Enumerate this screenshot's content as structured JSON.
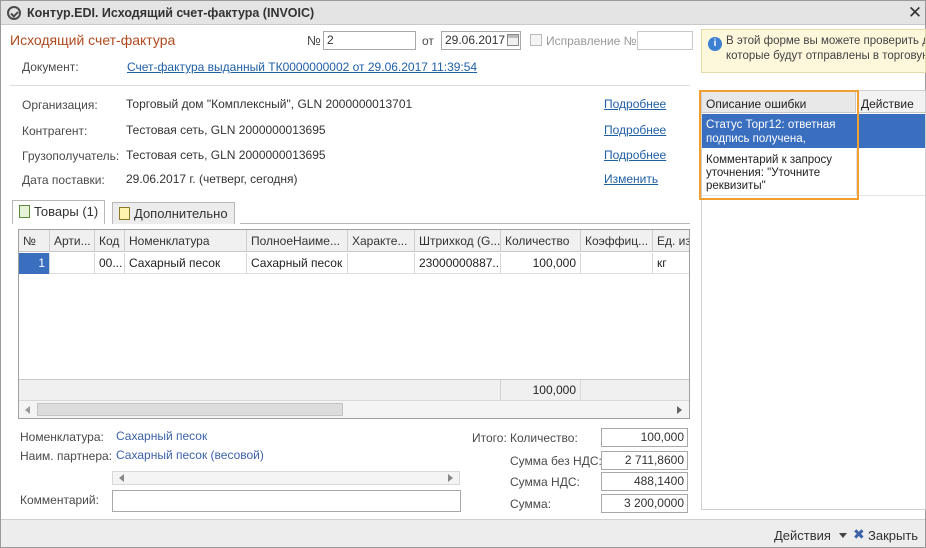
{
  "window": {
    "title": "Контур.EDI. Исходящий счет-фактура (INVOIC)"
  },
  "header": {
    "doc_type": "Исходящий счет-фактура",
    "number_label": "№",
    "number_value": "2",
    "date_label": "от",
    "date_value": "29.06.2017",
    "correction_label": "Исправление №",
    "correction_value": "",
    "document_label": "Документ:",
    "document_link": "Счет-фактура выданный ТК0000000002 от 29.06.2017 11:39:54"
  },
  "info": {
    "text_line1": "В этой форме вы можете проверить да",
    "text_line2": "которые будут отправлены в торговую"
  },
  "details": {
    "org_label": "Организация:",
    "org_value": "Торговый дом \"Комплексный\", GLN 2000000013701",
    "org_link": "Подробнее",
    "contragent_label": "Контрагент:",
    "contragent_value": "Тестовая сеть, GLN 2000000013695",
    "contragent_link": "Подробнее",
    "consignee_label": "Грузополучатель:",
    "consignee_value": "Тестовая сеть, GLN 2000000013695",
    "consignee_link": "Подробнее",
    "delivery_label": "Дата поставки:",
    "delivery_value": "29.06.2017 г. (четверг, сегодня)",
    "delivery_link": "Изменить"
  },
  "tabs": [
    {
      "label": "Товары (1)",
      "active": true
    },
    {
      "label": "Дополнительно",
      "active": false
    }
  ],
  "table": {
    "columns": [
      "№",
      "Арти...",
      "Код",
      "Номенклатура",
      "ПолноеНаиме...",
      "Характе...",
      "Штрихкод (G...",
      "Количество",
      "Коэффиц...",
      "Ед. из"
    ],
    "rows": [
      [
        "1",
        "",
        "00...",
        "Сахарный песок",
        "Сахарный песок",
        "",
        "23000000887...",
        "100,000",
        "",
        "кг"
      ]
    ],
    "footer_quantity": "100,000"
  },
  "summary": {
    "nomenclature_label": "Номенклатура:",
    "nomenclature_value": "Сахарный песок",
    "partner_name_label": "Наим. партнера:",
    "partner_name_value": "Сахарный песок (весовой)",
    "comment_label": "Комментарий:",
    "comment_value": "",
    "total_label": "Итого:",
    "qty_label": "Количество:",
    "qty_value": "100,000",
    "sum_no_vat_label": "Сумма без НДС:",
    "sum_no_vat_value": "2 711,8600",
    "vat_label": "Сумма НДС:",
    "vat_value": "488,1400",
    "sum_label": "Сумма:",
    "sum_value": "3 200,0000"
  },
  "errors": {
    "col_description": "Описание ошибки",
    "col_action": "Действие",
    "rows": [
      {
        "text": "Статус Торг12: ответная подпись получена,",
        "selected": true
      },
      {
        "text": "Комментарий к запросу уточнения: \"Уточните реквизиты\"",
        "selected": false
      }
    ],
    "highlight_color": "#f0a030",
    "selected_color": "#3a6fbf"
  },
  "footer": {
    "actions_label": "Действия",
    "close_label": "Закрыть"
  },
  "colors": {
    "doc_heading": "#b04a1e",
    "link": "#1f5fa6",
    "info_bg": "#fdf7dc"
  }
}
